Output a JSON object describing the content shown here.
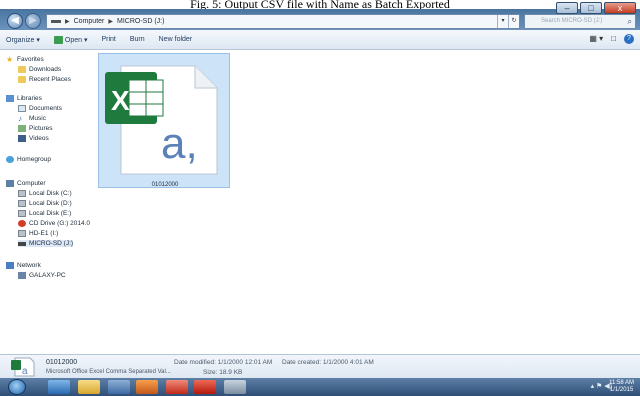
{
  "caption": "Fig. 5: Output CSV file with Name as Batch Exported",
  "address": {
    "crumbs": [
      "Computer",
      "MICRO-SD (J:)"
    ],
    "separator": "▶",
    "refresh_glyph": "↻",
    "dropdown_glyph": "▾"
  },
  "search": {
    "placeholder": "Search MICRO-SD (J:)",
    "icon": "search-icon"
  },
  "window_controls": {
    "minimize": "–",
    "maximize": "□",
    "close": "x"
  },
  "toolbar": {
    "organize": "Organize ▾",
    "open": "Open ▾",
    "print": "Print",
    "burn": "Burn",
    "new_folder": "New folder",
    "views_glyph": "▦ ▾",
    "preview_glyph": "□",
    "help_glyph": "?"
  },
  "sidebar": {
    "favorites": "Favorites",
    "downloads": "Downloads",
    "recent_places": "Recent Places",
    "libraries": "Libraries",
    "documents": "Documents",
    "music": "Music",
    "pictures": "Pictures",
    "videos": "Videos",
    "homegroup": "Homegroup",
    "computer": "Computer",
    "local_c": "Local Disk (C:)",
    "local_d": "Local Disk (D:)",
    "local_e": "Local Disk (E:)",
    "cd_drive": "CD Drive (G:) 2014.0-",
    "hd_e1": "HD-E1 (I:)",
    "micro_sd": "MICRO-SD (J:)",
    "network": "Network",
    "galaxy_pc": "GALAXY-PC",
    "music_glyph": "♪",
    "star_glyph": "★"
  },
  "file": {
    "name": "01012000",
    "icon_letter": "a,"
  },
  "details": {
    "name": "01012000",
    "type": "Microsoft Office Excel Comma Separated Val...",
    "modified": "Date modified: 1/1/2000 12:01 AM",
    "size": "Size: 18.9 KB",
    "created": "Date created: 1/1/2000 4:01 AM"
  },
  "taskbar": {
    "time": "11:58 AM",
    "date": "1/1/2015",
    "tray_glyphs": "▴ ⚑ ◀)"
  },
  "colors": {
    "excel_green": "#1f7a3d",
    "selection": "#cde3f7",
    "title_blue": "#4d79a5"
  }
}
